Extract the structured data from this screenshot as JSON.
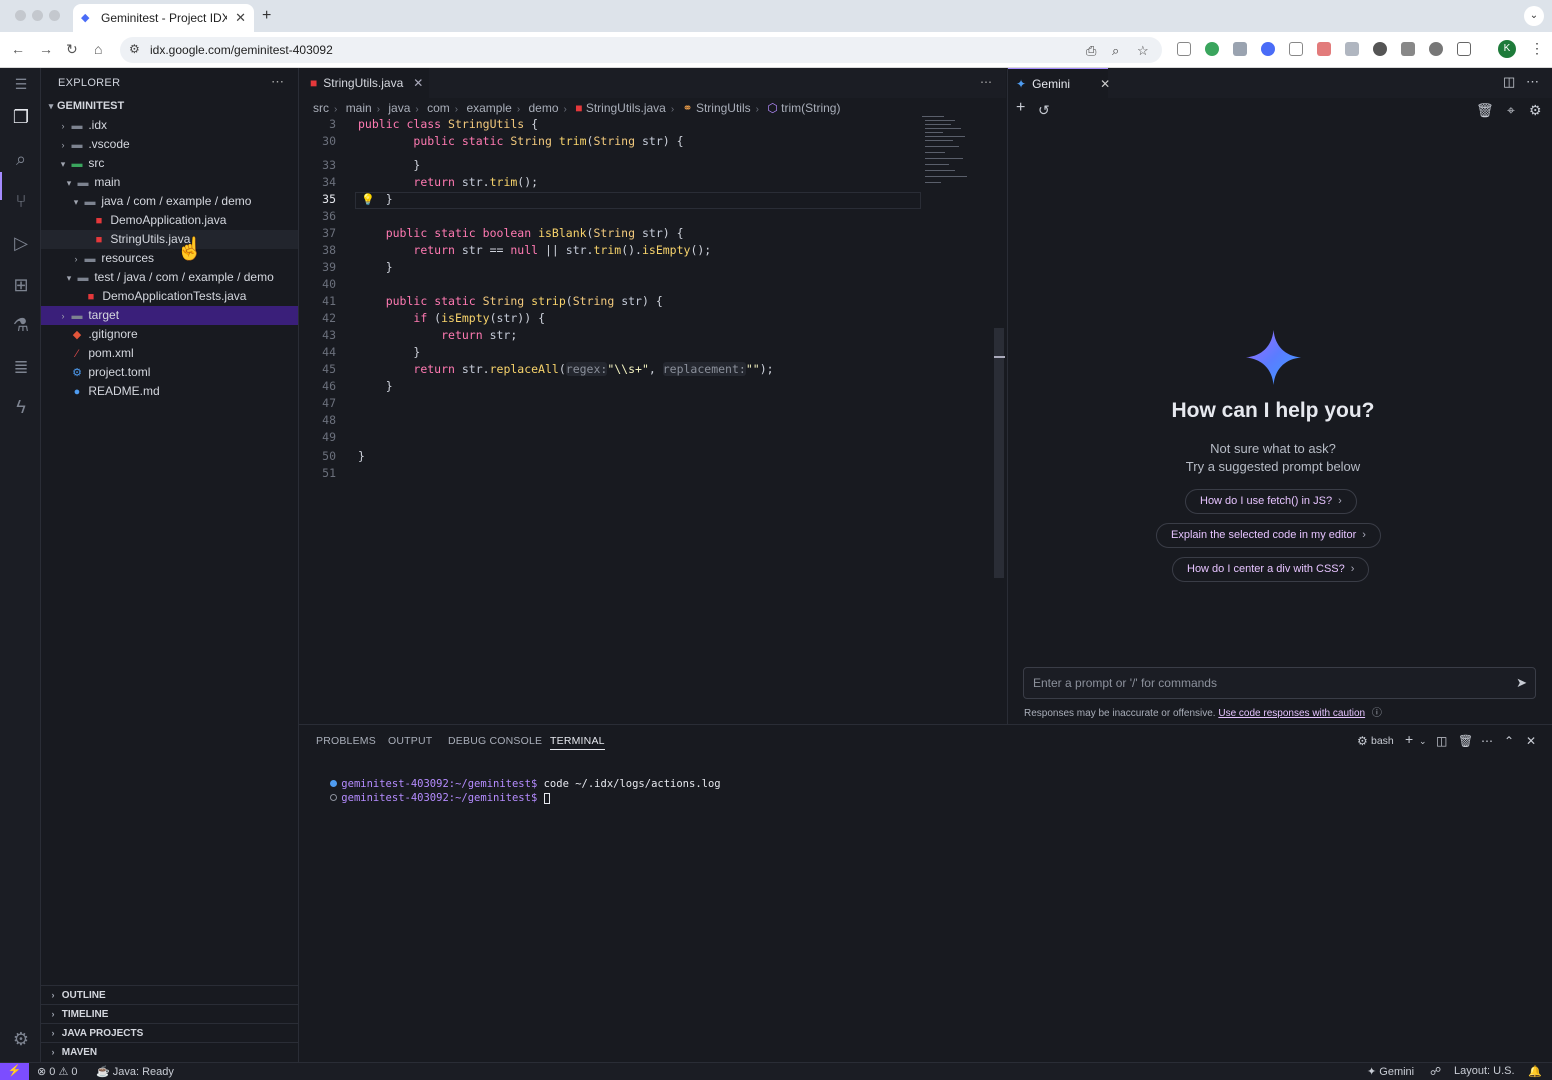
{
  "browser": {
    "tab_title": "Geminitest - Project IDX",
    "url": "idx.google.com/geminitest-403092",
    "profile_initial": "K"
  },
  "explorer": {
    "header": "EXPLORER",
    "root": "GEMINITEST",
    "items": [
      {
        "label": ".idx"
      },
      {
        "label": ".vscode"
      },
      {
        "label": "src"
      },
      {
        "label": "main"
      },
      {
        "label": "java / com / example / demo"
      },
      {
        "label": "DemoApplication.java"
      },
      {
        "label": "StringUtils.java"
      },
      {
        "label": "resources"
      },
      {
        "label": "test / java / com / example / demo"
      },
      {
        "label": "DemoApplicationTests.java"
      },
      {
        "label": "target"
      },
      {
        "label": ".gitignore"
      },
      {
        "label": "pom.xml"
      },
      {
        "label": "project.toml"
      },
      {
        "label": "README.md"
      }
    ],
    "sections": [
      "OUTLINE",
      "TIMELINE",
      "JAVA PROJECTS",
      "MAVEN"
    ]
  },
  "editor": {
    "tab_label": "StringUtils.java",
    "breadcrumbs": [
      "src",
      "main",
      "java",
      "com",
      "example",
      "demo",
      "StringUtils.java",
      "StringUtils",
      "trim(String)"
    ],
    "line_numbers": [
      "3",
      "30",
      "33",
      "34",
      "35",
      "36",
      "37",
      "38",
      "39",
      "40",
      "41",
      "42",
      "43",
      "44",
      "45",
      "46",
      "47",
      "48",
      "49",
      "50",
      "51"
    ],
    "current_line": "35"
  },
  "gemini": {
    "tab_label": "Gemini",
    "title": "How can I help you?",
    "subtitle_1": "Not sure what to ask?",
    "subtitle_2": "Try a suggested prompt below",
    "suggestions": [
      "How do I use fetch() in JS?",
      "Explain the selected code in my editor",
      "How do I center a div with CSS?"
    ],
    "prompt_placeholder": "Enter a prompt or '/' for commands",
    "disclaimer": "Responses may be inaccurate or offensive.",
    "disclaimer_link": "Use code responses with caution"
  },
  "panel": {
    "tabs": [
      "PROBLEMS",
      "OUTPUT",
      "DEBUG CONSOLE",
      "TERMINAL"
    ],
    "active_tab": "TERMINAL",
    "shell": "bash",
    "lines": [
      {
        "host": "geminitest-403092",
        "path": ":~/geminitest$",
        "cmd": " code ~/.idx/logs/actions.log"
      },
      {
        "host": "geminitest-403092",
        "path": ":~/geminitest$",
        "cmd": " "
      }
    ]
  },
  "status": {
    "errors": "0",
    "warnings": "0",
    "java": "Java: Ready",
    "gemini": "Gemini",
    "layout": "Layout: U.S."
  }
}
